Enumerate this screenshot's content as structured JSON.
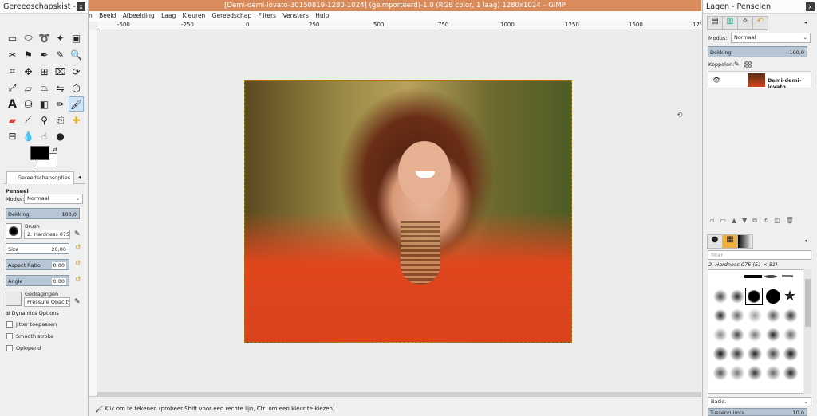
{
  "toolbox": {
    "title": "Gereedschapskist -...",
    "close": "x",
    "options_tab": "Gereedschapsopties",
    "tool_name": "Penseel",
    "mode_label": "Modus:",
    "mode_value": "Normaal",
    "opacity_label": "Dekking",
    "opacity_value": "100,0",
    "brush_label": "Brush",
    "brush_value": "2. Hardness 075",
    "size_label": "Size",
    "size_value": "20,00",
    "aspect_label": "Aspect Ratio",
    "aspect_value": "0,00",
    "angle_label": "Angle",
    "angle_value": "0,00",
    "dynamics_label": "Gedragingen",
    "dynamics_value": "Pressure Opacity",
    "dyn_options": "Dynamics Options",
    "jitter": "Jitter toepassen",
    "smooth": "Smooth stroke",
    "incremental": "Oplopend"
  },
  "window": {
    "title": "[Demi-demi-lovato-30150819-1280-1024] (geïmporteerd)-1.0 (RGB color, 1 laag) 1280x1024 – GIMP"
  },
  "menu": [
    "n",
    "Beeld",
    "Afbeelding",
    "Laag",
    "Kleuren",
    "Gereedschap",
    "Filters",
    "Vensters",
    "Hulp"
  ],
  "ruler": [
    "-500",
    "-250",
    "0",
    "250",
    "500",
    "750",
    "1000",
    "1250",
    "1500",
    "1750"
  ],
  "status": {
    "text": "Klik om te tekenen (probeer Shift voor een rechte lijn, Ctrl om een kleur te kiezen)"
  },
  "dock": {
    "title": "Lagen - Penselen",
    "mode_label": "Modus:",
    "mode_value": "Normaal",
    "opacity_label": "Dekking",
    "opacity_value": "100,0",
    "lock_label": "Koppelen:",
    "layer_name": "Demi-demi-lovato",
    "filter_placeholder": "filter",
    "brush_name": "2. Hardness 075 (51 × 51)",
    "preset": "Basic.",
    "spacing_label": "Tussenruimte",
    "spacing_value": "10,0"
  },
  "colors": {
    "accent": "#d98b5b",
    "slider": "#b6c6d4"
  }
}
